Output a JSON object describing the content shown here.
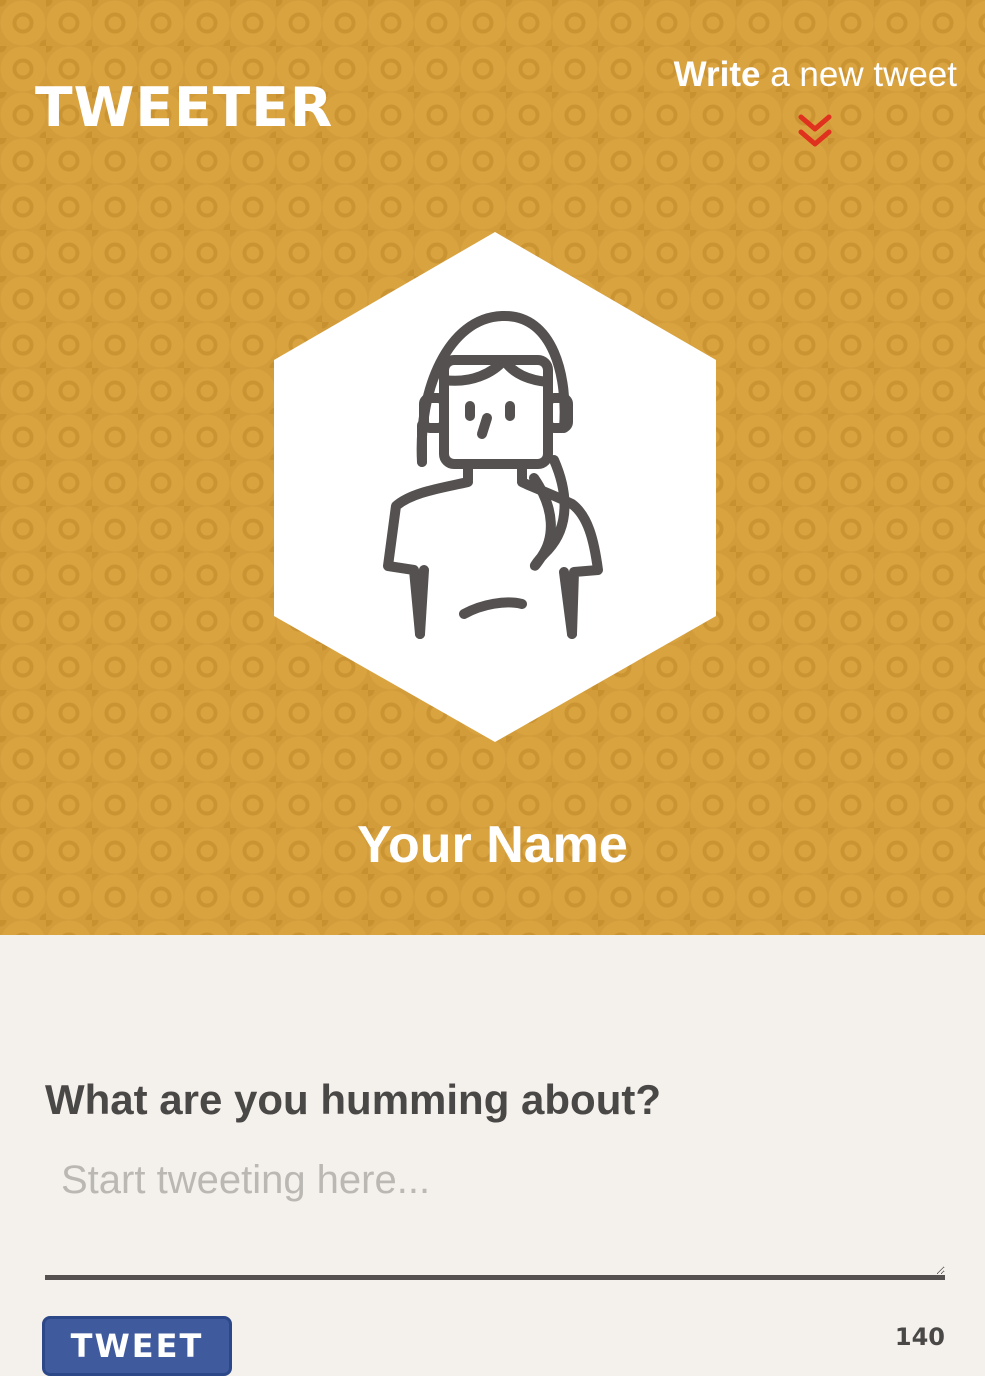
{
  "header": {
    "logo_text": "TWEETER",
    "write_link": {
      "strong": "Write",
      "rest": " a new tweet"
    },
    "chevron_icon": "double-chevron-down",
    "chevron_color": "#e0301e"
  },
  "profile": {
    "avatar_icon": "woman-avatar",
    "name": "Your Name",
    "background_color": "#d39c3b"
  },
  "composer": {
    "label": "What are you humming about?",
    "input_value": "",
    "placeholder": "Start tweeting here...",
    "submit_label": "TWEET",
    "char_count": "140",
    "button_color": "#3f5a9d"
  }
}
